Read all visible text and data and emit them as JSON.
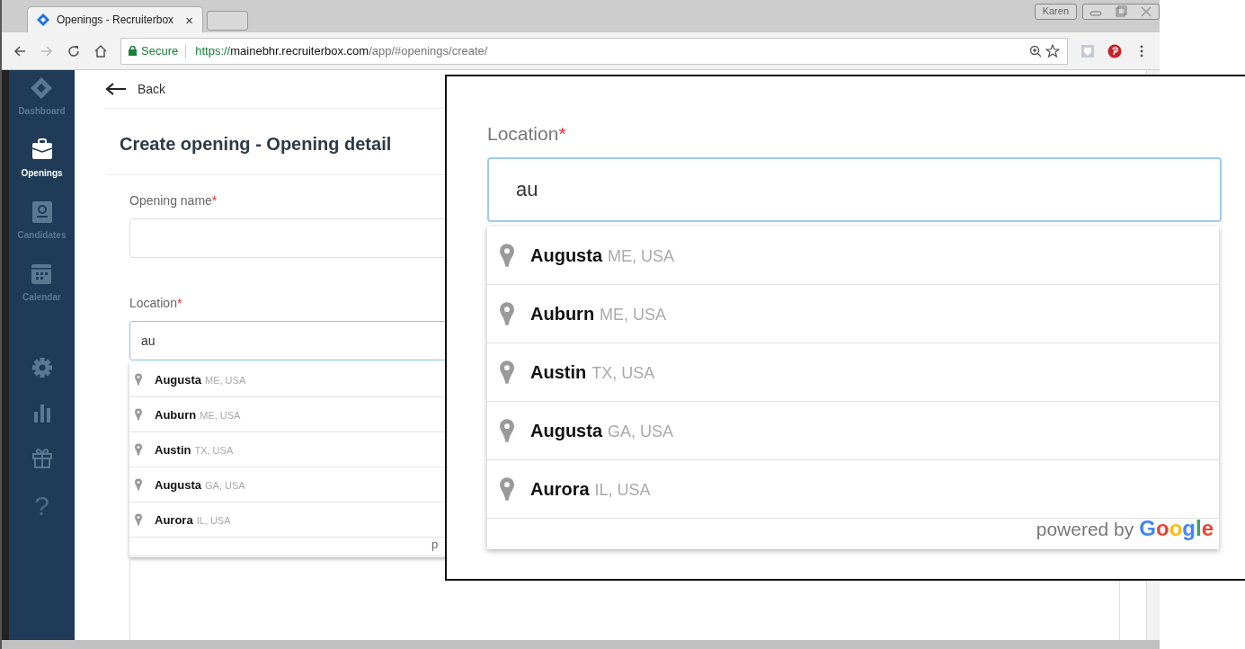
{
  "browser": {
    "tab_title": "Openings - Recruiterbox",
    "tab_close": "×",
    "profile": "Karen",
    "secure_label": "Secure",
    "url_scheme": "https://",
    "url_host": "mainebhr.recruiterbox.com",
    "url_path": "/app/#openings/create/"
  },
  "sidebar": {
    "items": [
      {
        "kind": "logo",
        "label": "Dashboard",
        "selected": false
      },
      {
        "kind": "briefcase",
        "label": "Openings",
        "selected": true
      },
      {
        "kind": "candidate",
        "label": "Candidates",
        "selected": false
      },
      {
        "kind": "calendar",
        "label": "Calendar",
        "selected": false
      },
      {
        "kind": "gear"
      },
      {
        "kind": "bars"
      },
      {
        "kind": "gift"
      },
      {
        "kind": "glyph",
        "glyph": "?"
      }
    ]
  },
  "page": {
    "back": "Back",
    "title": "Create opening - Opening detail",
    "fields": [
      {
        "label": "Opening name",
        "required_mark": "*"
      },
      {
        "label": "Location",
        "required_mark": "*",
        "value": "au"
      }
    ],
    "suggestions": [
      {
        "name": "Augusta",
        "detail": "ME, USA"
      },
      {
        "name": "Auburn",
        "detail": "ME, USA"
      },
      {
        "name": "Austin",
        "detail": "TX, USA"
      },
      {
        "name": "Augusta",
        "detail": "GA, USA"
      },
      {
        "name": "Aurora",
        "detail": "IL, USA"
      }
    ],
    "footer": "p"
  },
  "inset": {
    "label": "Location",
    "required_mark": "*",
    "value": "au",
    "suggestions": [
      {
        "name": "Augusta",
        "detail": "ME, USA"
      },
      {
        "name": "Auburn",
        "detail": "ME, USA"
      },
      {
        "name": "Austin",
        "detail": "TX, USA"
      },
      {
        "name": "Augusta",
        "detail": "GA, USA"
      },
      {
        "name": "Aurora",
        "detail": "IL, USA"
      }
    ],
    "footer": "powered by",
    "brand": "Google"
  }
}
